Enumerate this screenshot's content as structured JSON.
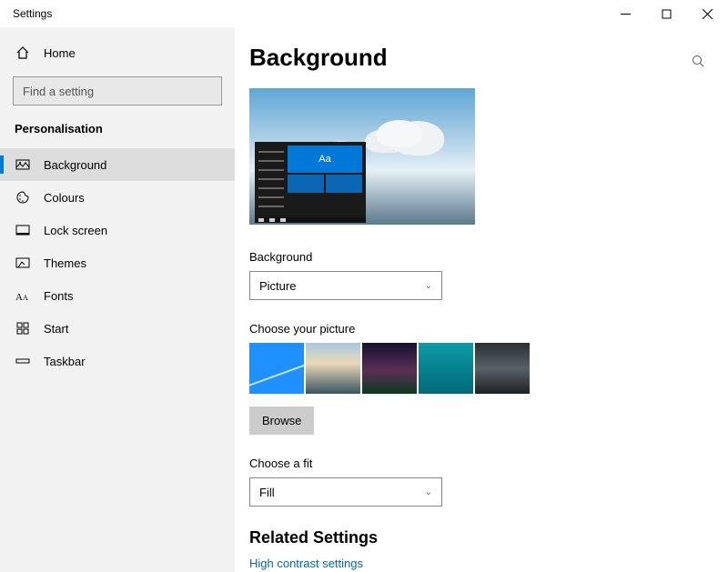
{
  "window": {
    "title": "Settings"
  },
  "sidebar": {
    "home_label": "Home",
    "search_placeholder": "Find a setting",
    "section_header": "Personalisation",
    "items": [
      {
        "label": "Background",
        "icon": "picture-icon"
      },
      {
        "label": "Colours",
        "icon": "palette-icon"
      },
      {
        "label": "Lock screen",
        "icon": "lockscreen-icon"
      },
      {
        "label": "Themes",
        "icon": "themes-icon"
      },
      {
        "label": "Fonts",
        "icon": "fonts-icon"
      },
      {
        "label": "Start",
        "icon": "start-icon"
      },
      {
        "label": "Taskbar",
        "icon": "taskbar-icon"
      }
    ]
  },
  "main": {
    "page_title": "Background",
    "preview_sample_text": "Aa",
    "background_label": "Background",
    "background_value": "Picture",
    "choose_picture_label": "Choose your picture",
    "browse_label": "Browse",
    "choose_fit_label": "Choose a fit",
    "fit_value": "Fill",
    "related_title": "Related Settings",
    "links": [
      {
        "label": "High contrast settings"
      }
    ]
  }
}
